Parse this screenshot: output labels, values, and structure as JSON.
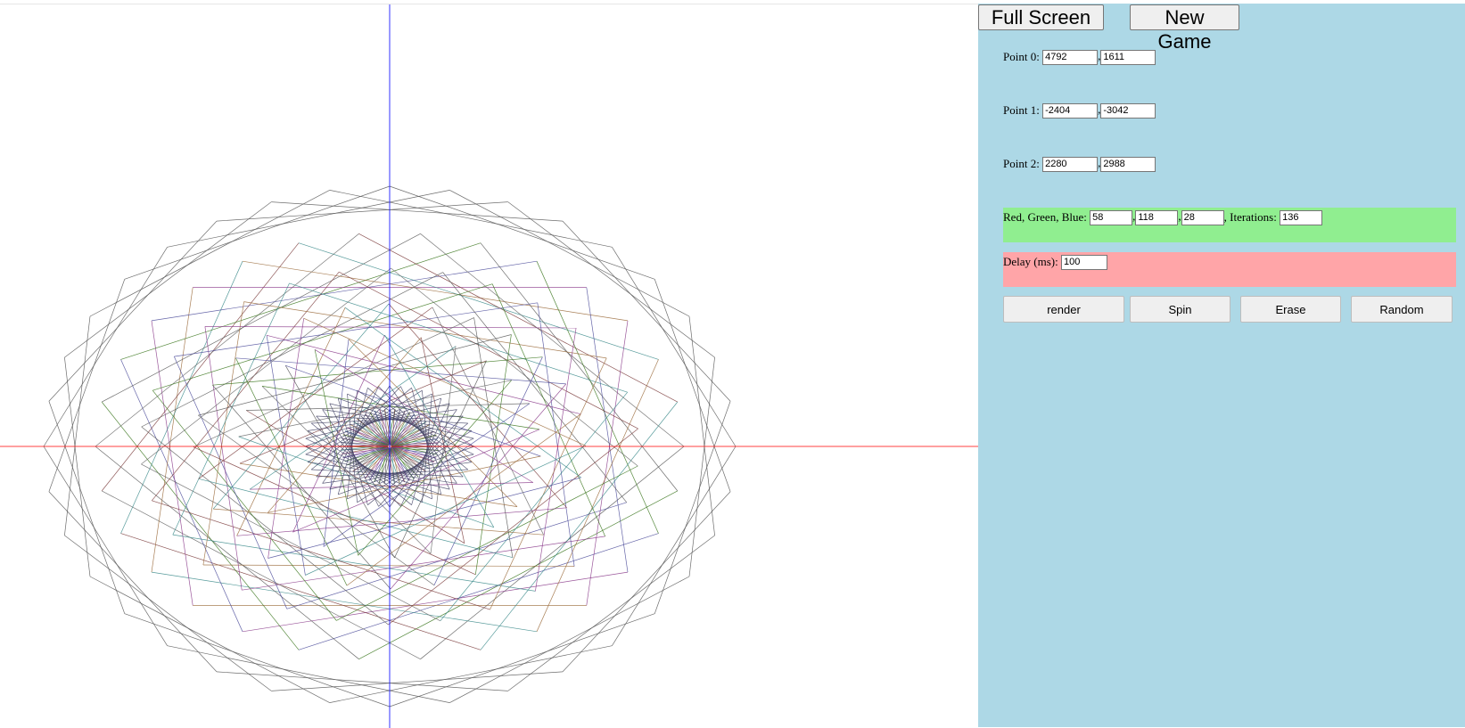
{
  "toolbar": {
    "fullscreen_label": "Full Screen",
    "newgame_label": "New Game"
  },
  "points": [
    {
      "label": "Point 0:",
      "x": "4792",
      "y": "1611"
    },
    {
      "label": "Point 1:",
      "x": "-2404",
      "y": "-3042"
    },
    {
      "label": "Point 2:",
      "x": "2280",
      "y": "2988"
    }
  ],
  "separator": ",",
  "color": {
    "label": "Red, Green, Blue:",
    "red": "58",
    "green": "118",
    "blue": "28",
    "iterations_label": ", Iterations:",
    "iterations": "136"
  },
  "delay": {
    "label": "Delay (ms):",
    "value": "100"
  },
  "actions": {
    "render": "render",
    "spin": "Spin",
    "erase": "Erase",
    "random": "Random"
  },
  "colors": {
    "panel_bg": "#add8e6",
    "rgb_bg": "#90ee90",
    "delay_bg": "#ffa5a8",
    "x_axis": "#ff0000",
    "y_axis": "#0000ff"
  }
}
